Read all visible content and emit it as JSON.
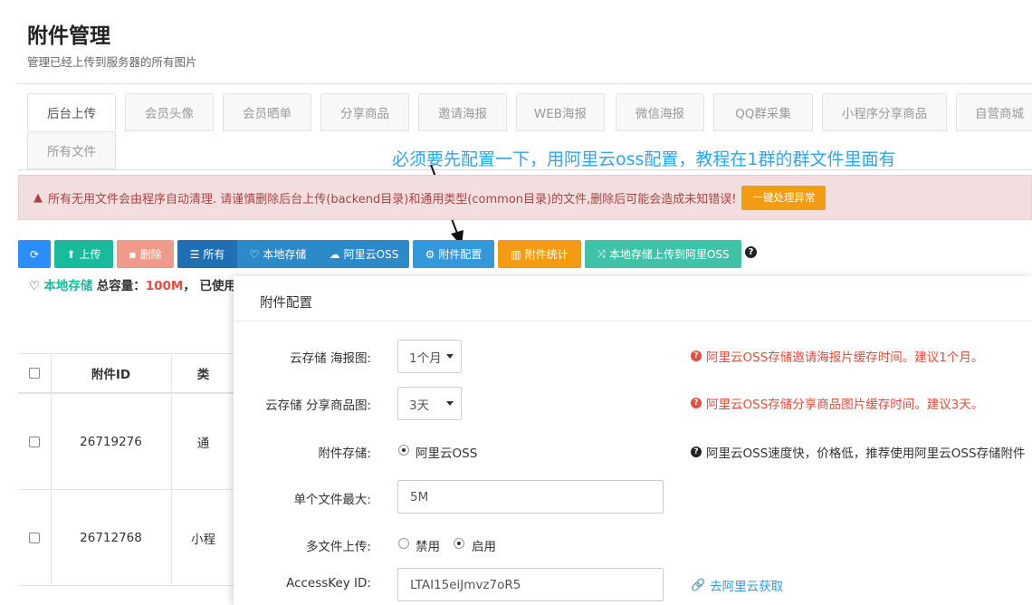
{
  "header": {
    "title": "附件管理",
    "subtitle": "管理已经上传到服务器的所有图片"
  },
  "tabs": [
    {
      "label": "后台上传",
      "active": true
    },
    {
      "label": "会员头像"
    },
    {
      "label": "会员晒单"
    },
    {
      "label": "分享商品"
    },
    {
      "label": "邀请海报"
    },
    {
      "label": "WEB海报"
    },
    {
      "label": "微信海报"
    },
    {
      "label": "QQ群采集"
    },
    {
      "label": "小程序分享商品"
    },
    {
      "label": "自营商城"
    },
    {
      "label": "所有文件"
    }
  ],
  "annotation": "必须要先配置一下，用阿里云oss配置，教程在1群的群文件里面有",
  "alert": {
    "text": "所有无用文件会由程序自动清理. 请谨慎删除后台上传(backend目录)和通用类型(common目录)的文件,删除后可能会造成未知错误!",
    "button": "一键处理异常"
  },
  "toolbar": {
    "buttons": [
      {
        "label": "",
        "icon": "refresh-icon",
        "color": "#2c8ef8"
      },
      {
        "label": "上传",
        "icon": "upload-icon",
        "color": "#18bc9c"
      },
      {
        "label": "删除",
        "icon": "trash-icon",
        "color": "#f09a8c"
      },
      {
        "label": "所有",
        "icon": "list-icon",
        "color": "#1f6fb2"
      },
      {
        "label": "本地存储",
        "icon": "heart-icon",
        "color": "#2c8ac9"
      },
      {
        "label": "阿里云OSS",
        "icon": "cloud-icon",
        "color": "#2c8ac9"
      },
      {
        "label": "附件配置",
        "icon": "gears-icon",
        "color": "#3498db"
      },
      {
        "label": "附件统计",
        "icon": "bar-chart-icon",
        "color": "#f39c12"
      },
      {
        "label": "本地存储上传到阿里OSS",
        "icon": "shuffle-icon",
        "color": "#3fc2a6"
      }
    ]
  },
  "storage": {
    "name": "本地存储",
    "total_label": "总容量：",
    "total_value": "100M",
    "used_label": "，  已使用"
  },
  "table": {
    "headers": [
      "附件ID",
      "类"
    ],
    "rows": [
      {
        "id": "26719276",
        "type": "通"
      },
      {
        "id": "26712768",
        "type": "小程"
      }
    ]
  },
  "modal": {
    "title": "附件配置",
    "fields": {
      "poster_label": "云存储 海报图:",
      "poster_value": "1个月",
      "poster_hint": "阿里云OSS存储邀请海报片缓存时间。建议1个月。",
      "share_label": "云存储 分享商品图:",
      "share_value": "3天",
      "share_hint": "阿里云OSS存储分享商品图片缓存时间。建议3天。",
      "storage_label": "附件存储:",
      "storage_option": "阿里云OSS",
      "storage_hint": "阿里云OSS速度快，价格低，推荐使用阿里云OSS存储附件",
      "maxsize_label": "单个文件最大:",
      "maxsize_value": "5M",
      "multi_label": "多文件上传:",
      "multi_off": "禁用",
      "multi_on": "启用",
      "key_label": "AccessKey ID:",
      "key_value": "LTAI15eiJmvz7oR5",
      "key_link": "去阿里云获取"
    }
  },
  "colors": {
    "annotation": "#2aa6f2",
    "alert_bg": "#f2dede",
    "alert_text": "#a94442",
    "hint_red": "#e74c3c",
    "link": "#3498db"
  }
}
